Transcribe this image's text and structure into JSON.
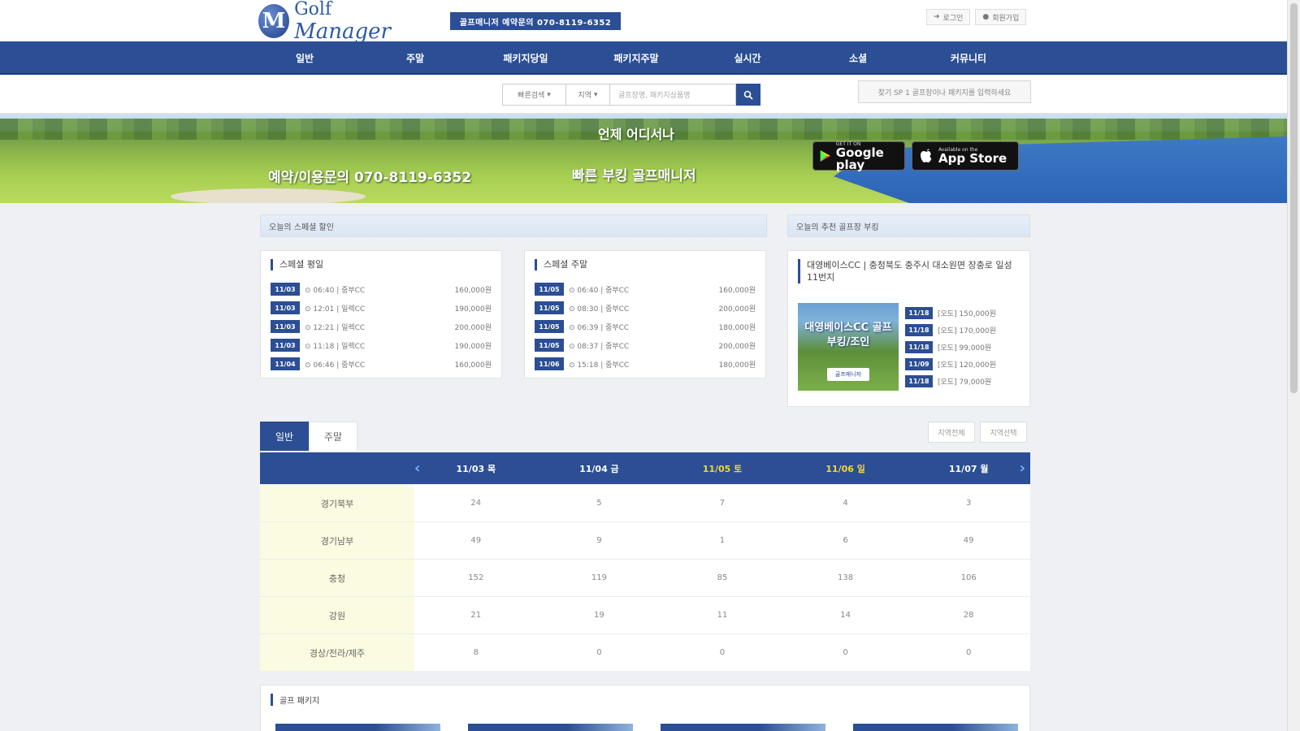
{
  "header": {
    "logo_mark": "M",
    "logo_text_1": "Golf",
    "logo_text_2": "Manager",
    "hotline": "골프매니저 예약문의 070-8119-6352",
    "login": "로그인",
    "signup": "회원가입"
  },
  "nav": [
    "일반",
    "주말",
    "패키지당일",
    "패키지주말",
    "실시간",
    "소셜",
    "커뮤니티"
  ],
  "search": {
    "select1": "빠른검색",
    "select2": "지역",
    "placeholder": "골프장명, 패키지상품명",
    "promo": "찾기 SP 1 골프장이나 패키지를 입력하세요"
  },
  "banner": {
    "phone": "예약/이용문의 070-8119-6352",
    "line1": "언제 어디서나",
    "line2": "빠른 부킹 골프매니저",
    "google_small": "GET IT ON",
    "google_big": "Google play",
    "apple_small": "Available on the",
    "apple_big": "App Store"
  },
  "today_header": "오늘의 스페셜 할인",
  "rec_header": "오늘의 추천 골프장 부킹",
  "weekday": {
    "title": "스페셜 평일",
    "rows": [
      {
        "date": "11/03",
        "info": "⊙ 06:40 | 중부CC",
        "price": "160,000원"
      },
      {
        "date": "11/03",
        "info": "⊙ 12:01 | 일렉CC",
        "price": "190,000원"
      },
      {
        "date": "11/03",
        "info": "⊙ 12:21 | 일렉CC",
        "price": "200,000원"
      },
      {
        "date": "11/03",
        "info": "⊙ 11:18 | 일렉CC",
        "price": "190,000원"
      },
      {
        "date": "11/04",
        "info": "⊙ 06:46 | 중부CC",
        "price": "160,000원"
      }
    ]
  },
  "weekend": {
    "title": "스페셜 주말",
    "rows": [
      {
        "date": "11/05",
        "info": "⊙ 06:40 | 중부CC",
        "price": "160,000원"
      },
      {
        "date": "11/05",
        "info": "⊙ 08:30 | 중부CC",
        "price": "200,000원"
      },
      {
        "date": "11/05",
        "info": "⊙ 06:39 | 중부CC",
        "price": "180,000원"
      },
      {
        "date": "11/05",
        "info": "⊙ 08:37 | 중부CC",
        "price": "200,000원"
      },
      {
        "date": "11/06",
        "info": "⊙ 15:18 | 중부CC",
        "price": "180,000원"
      }
    ]
  },
  "recommend": {
    "title": "대영베이스CC | 충청북도 충주시 대소원면 장충로 일성 11번지",
    "image_label": "대영베이스CC 골프부킹/조인",
    "image_badge": "골프매니저",
    "rows": [
      {
        "date": "11/18",
        "info": "[오도] 150,000원"
      },
      {
        "date": "11/18",
        "info": "[오도] 170,000원"
      },
      {
        "date": "11/18",
        "info": "[오도] 99,000원"
      },
      {
        "date": "11/09",
        "info": "[오도] 120,000원"
      },
      {
        "date": "11/18",
        "info": "[오도] 79,000원"
      }
    ]
  },
  "tabs": [
    "일반",
    "주말"
  ],
  "side_buttons": [
    "지역전체",
    "지역선택"
  ],
  "grid": {
    "dates": [
      "11/03 목",
      "11/04 금",
      "11/05 토",
      "11/06 일",
      "11/07 월"
    ],
    "highlight_index": [
      2,
      3
    ],
    "rows": [
      {
        "label": "경기북부",
        "values": [
          "24",
          "5",
          "7",
          "4",
          "3"
        ]
      },
      {
        "label": "경기남부",
        "values": [
          "49",
          "9",
          "1",
          "6",
          "49"
        ]
      },
      {
        "label": "충청",
        "values": [
          "152",
          "119",
          "85",
          "138",
          "106"
        ]
      },
      {
        "label": "강원",
        "values": [
          "21",
          "19",
          "11",
          "14",
          "28"
        ]
      },
      {
        "label": "경상/전라/제주",
        "values": [
          "8",
          "0",
          "0",
          "0",
          "0"
        ]
      }
    ]
  },
  "packages_title": "골프 패키지",
  "colors": {
    "primary": "#2b4e94",
    "highlight": "#f3d63a",
    "label_bg": "#fbfbe1"
  }
}
